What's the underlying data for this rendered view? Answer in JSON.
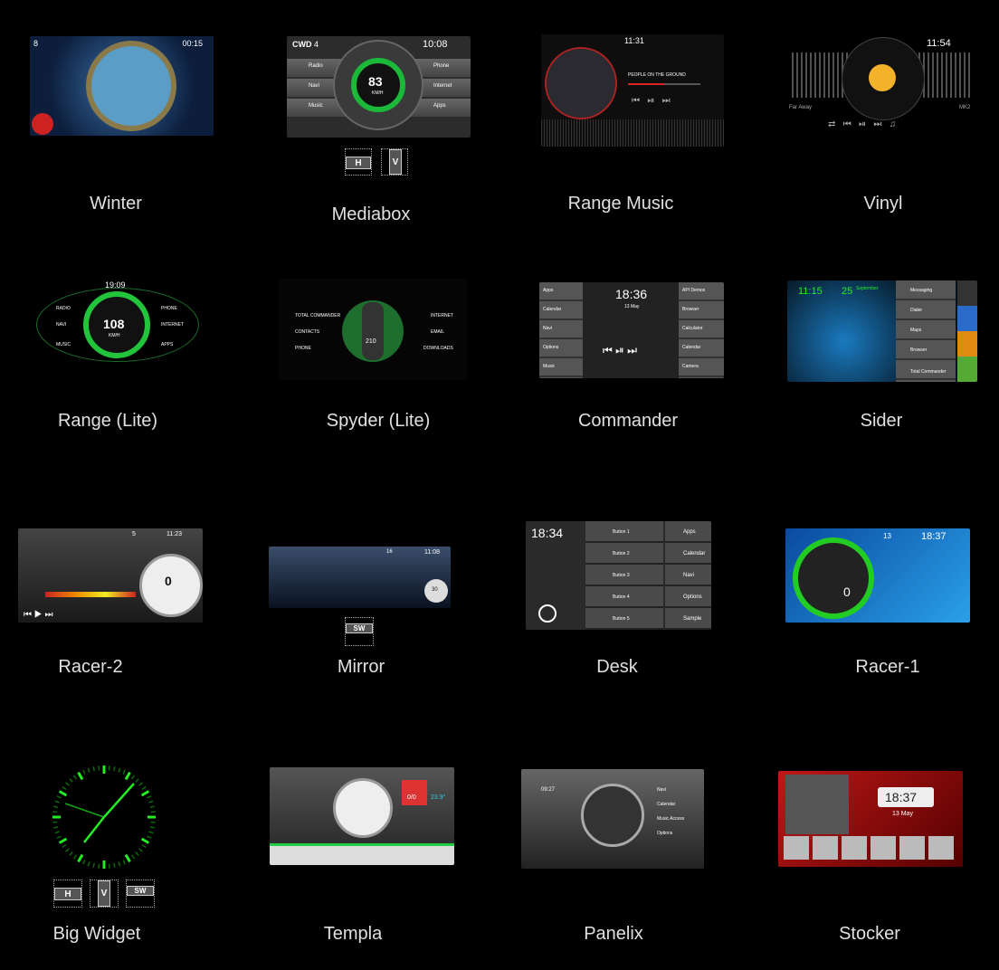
{
  "themes": [
    {
      "name": "Winter",
      "time": "00:15",
      "date": "8"
    },
    {
      "name": "Mediabox",
      "time": "10:08",
      "date": "4",
      "speed": "83",
      "unit": "KM/H",
      "items_left": [
        "Radio",
        "Navi",
        "Music"
      ],
      "items_right": [
        "Phone",
        "Internet",
        "Apps"
      ],
      "modes": [
        "H",
        "V"
      ]
    },
    {
      "name": "Range Music",
      "time": "11:31",
      "track": "PEOPLE ON THE GROUND"
    },
    {
      "name": "Vinyl",
      "time": "11:54",
      "left_text": "Far Away",
      "right_text": "MK2"
    },
    {
      "name": "Range (Lite)",
      "time": "19:09",
      "speed": "108",
      "unit": "KM/H",
      "items_left": [
        "RADIO",
        "NAVI",
        "MUSIC"
      ],
      "items_right": [
        "PHONE",
        "INTERNET",
        "APPS"
      ]
    },
    {
      "name": "Spyder (Lite)",
      "speed": "210",
      "items_left": [
        "TOTAL COMMANDER",
        "CONTACTS",
        "PHONE"
      ],
      "items_right": [
        "INTERNET",
        "EMAIL",
        "DOWNLOADS"
      ]
    },
    {
      "name": "Commander",
      "time": "18:36",
      "date": "13 May",
      "items_left": [
        "Apps",
        "Calendar",
        "Navi",
        "Options",
        "Music"
      ],
      "items_right": [
        "API Demos",
        "Browser",
        "Calculator",
        "Calendar",
        "Camera"
      ]
    },
    {
      "name": "Sider",
      "time": "11:15",
      "date": "25",
      "month": "September",
      "items": [
        "Messaging",
        "Dialer",
        "Maps",
        "Browser",
        "Total Commander"
      ]
    },
    {
      "name": "Racer-2",
      "time": "11:23",
      "date": "5",
      "speed": "0"
    },
    {
      "name": "Mirror",
      "time": "11:08",
      "date": "16",
      "speed": "30",
      "modes": [
        "SW"
      ]
    },
    {
      "name": "Desk",
      "time": "18:34",
      "items_left": [
        "Button 1",
        "Button 2",
        "Button 3",
        "Button 4",
        "Button 5"
      ],
      "items_right": [
        "Apps",
        "Calendar",
        "Navi",
        "Options",
        "Sample"
      ]
    },
    {
      "name": "Racer-1",
      "time": "18:37",
      "date": "13",
      "speed": "0"
    },
    {
      "name": "Big Widget",
      "modes": [
        "H",
        "V",
        "SW"
      ]
    },
    {
      "name": "Templa",
      "counter": "0/0",
      "temp": "23.9°"
    },
    {
      "name": "Panelix",
      "time": "09:27",
      "items": [
        "Navi",
        "Calendar",
        "Music Access",
        "Options"
      ]
    },
    {
      "name": "Stocker",
      "time": "18:37",
      "date": "13 May"
    }
  ],
  "colors": {
    "accent_green": "#22dd22",
    "background": "#000000",
    "label": "#e0e0e0"
  }
}
